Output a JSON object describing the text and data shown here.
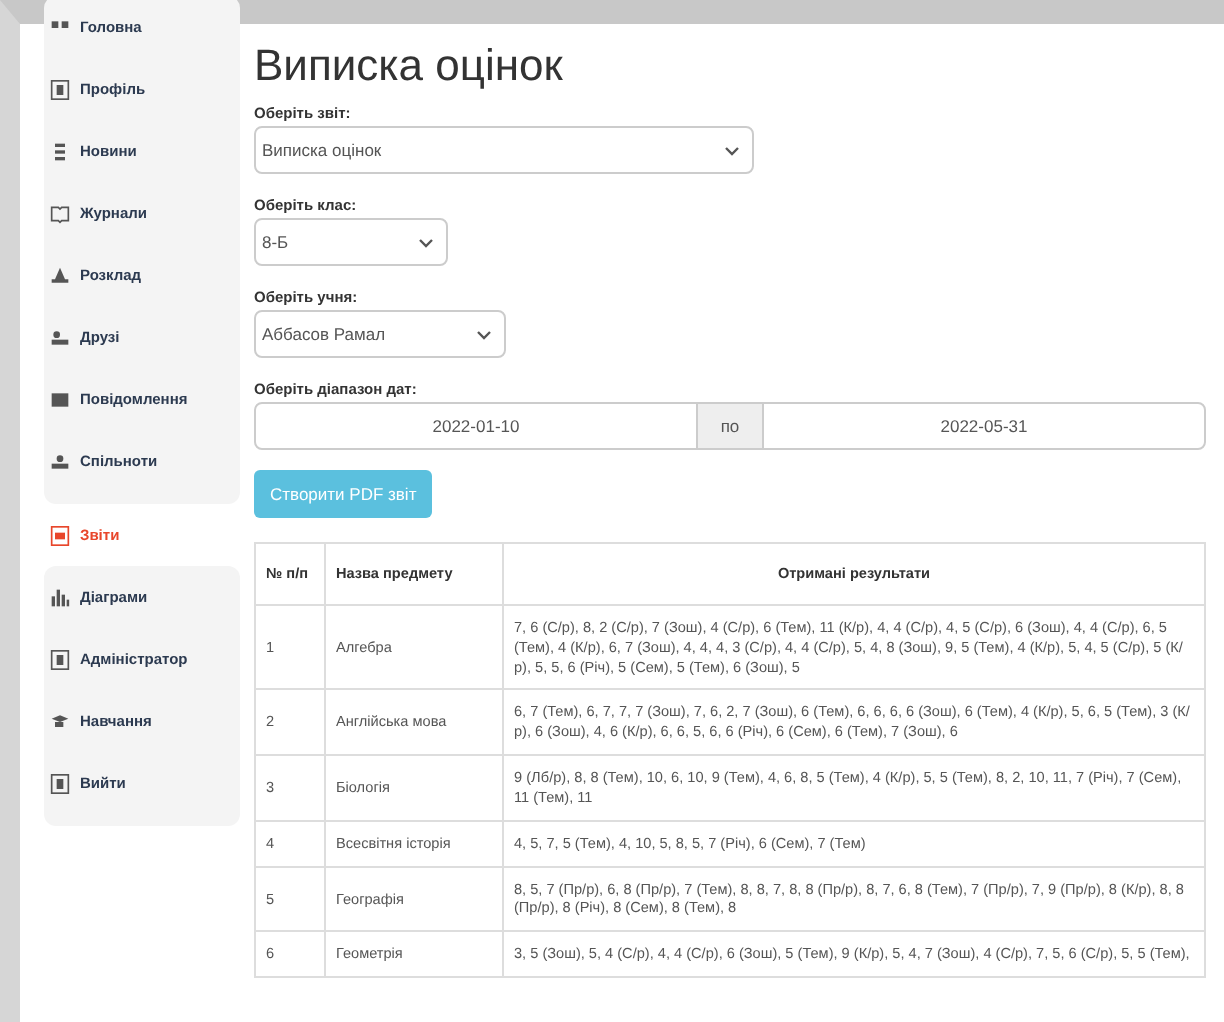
{
  "sidebar": {
    "items": [
      {
        "label": "Головна",
        "selected": false
      },
      {
        "label": "Профіль",
        "selected": false
      },
      {
        "label": "Новини",
        "selected": false
      },
      {
        "label": "Журнали",
        "selected": false
      },
      {
        "label": "Розклад",
        "selected": false
      },
      {
        "label": "Друзі",
        "selected": false
      },
      {
        "label": "Повідомлення",
        "selected": false
      },
      {
        "label": "Спільноти",
        "selected": false
      },
      {
        "label": "Звіти",
        "selected": true
      },
      {
        "label": "Діаграми",
        "selected": false
      },
      {
        "label": "Адміністратор",
        "selected": false
      },
      {
        "label": "Навчання",
        "selected": false
      },
      {
        "label": "Вийти",
        "selected": false
      }
    ]
  },
  "page": {
    "title": "Виписка оцінок",
    "report": {
      "label": "Оберіть звіт:",
      "value": "Виписка оцінок"
    },
    "class": {
      "label": "Оберіть клас:",
      "value": "8-Б"
    },
    "student": {
      "label": "Оберіть учня:",
      "value": "Аббасов Рамал"
    },
    "dates": {
      "label": "Оберіть діапазон дат:",
      "from": "2022-01-10",
      "separator": "по",
      "to": "2022-05-31"
    },
    "button": "Створити PDF звіт"
  },
  "table": {
    "columns": [
      "№ п/п",
      "Назва предмету",
      "Отримані результати"
    ],
    "rows": [
      [
        "1",
        "Алгебра",
        "7, 6 (С/р), 8, 2 (С/р), 7 (Зош), 4 (С/р), 6 (Тем), 11 (К/р), 4, 4 (С/р), 4, 5 (С/р), 6 (Зош), 4, 4 (С/р), 6, 5 (Тем), 4 (К/р), 6, 7 (Зош), 4, 4, 4, 3 (С/р), 4, 4 (С/р), 5, 4, 8 (Зош), 9, 5 (Тем), 4 (К/р), 5, 4, 5 (С/р), 5 (К/р), 5, 5, 6 (Річ), 5 (Сем), 5 (Тем), 6 (Зош), 5"
      ],
      [
        "2",
        "Англійська мова",
        "6, 7 (Тем), 6, 7, 7, 7 (Зош), 7, 6, 2, 7 (Зош), 6 (Тем), 6, 6, 6, 6 (Зош), 6 (Тем), 4 (К/р), 5, 6, 5 (Тем), 3 (К/р), 6 (Зош), 4, 6 (К/р), 6, 6, 5, 6, 6 (Річ), 6 (Сем), 6 (Тем), 7 (Зош), 6"
      ],
      [
        "3",
        "Біологія",
        "9 (Лб/р), 8, 8 (Тем), 10, 6, 10, 9 (Тем), 4, 6, 8, 5 (Тем), 4 (К/р), 5, 5 (Тем), 8, 2, 10, 11, 7 (Річ), 7 (Сем), 11 (Тем), 11"
      ],
      [
        "4",
        "Всесвітня історія",
        "4, 5, 7, 5 (Тем), 4, 10, 5, 8, 5, 7 (Річ), 6 (Сем), 7 (Тем)"
      ],
      [
        "5",
        "Географія",
        "8, 5, 7 (Пр/р), 6, 8 (Пр/р), 7 (Тем), 8, 8, 7, 8, 8 (Пр/р), 8, 7, 6, 8 (Тем), 7 (Пр/р), 7, 9 (Пр/р), 8 (К/р), 8, 8 (Пр/р), 8 (Річ), 8 (Сем), 8 (Тем), 8"
      ],
      [
        "6",
        "Геометрія",
        "3, 5 (Зош), 5, 4 (С/р), 4, 4 (С/р), 6 (Зош), 5 (Тем), 9 (К/р), 5, 4, 7 (Зош), 4 (С/р), 7, 5, 6 (С/р), 5, 5 (Тем),"
      ]
    ]
  }
}
